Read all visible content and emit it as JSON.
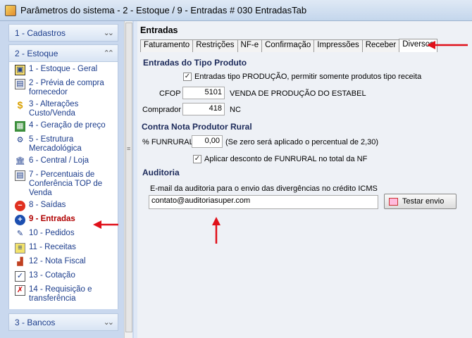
{
  "window": {
    "title": "Parâmetros do sistema - 2 - Estoque / 9 - Entradas # 030 EntradasTab"
  },
  "sidebar": {
    "group_cadastros": "1 - Cadastros",
    "group_estoque": "2 - Estoque",
    "group_bancos": "3 - Bancos",
    "items": [
      {
        "label": "1 - Estoque - Geral",
        "icon": "stock-icon"
      },
      {
        "label": "2 - Prévia de compra fornecedor",
        "icon": "document-icon"
      },
      {
        "label": "3 - Alterações Custo/Venda",
        "icon": "dollar-icon"
      },
      {
        "label": "4 - Geração de preço",
        "icon": "price-icon"
      },
      {
        "label": "5 - Estrutura Mercadológica",
        "icon": "structure-icon"
      },
      {
        "label": "6 - Central / Loja",
        "icon": "building-icon"
      },
      {
        "label": "7 - Percentuais de Conferência TOP de Venda",
        "icon": "document-icon"
      },
      {
        "label": "8 - Saídas",
        "icon": "minus-icon"
      },
      {
        "label": "9 - Entradas",
        "icon": "plus-icon"
      },
      {
        "label": "10 - Pedidos",
        "icon": "orders-icon"
      },
      {
        "label": "11 - Receitas",
        "icon": "recipes-icon"
      },
      {
        "label": "12 - Nota Fiscal",
        "icon": "invoice-icon"
      },
      {
        "label": "13 - Cotação",
        "icon": "quote-icon"
      },
      {
        "label": "14 - Requisição e transferência",
        "icon": "transfer-icon"
      }
    ]
  },
  "main": {
    "title": "Entradas",
    "tabs": [
      "Faturamento",
      "Restrições",
      "NF-e",
      "Confirmação",
      "Impressões",
      "Receber",
      "Diversos"
    ],
    "active_tab": "Diversos",
    "tipo_produto": {
      "header": "Entradas do Tipo Produto",
      "checkbox_label": "Entradas tipo PRODUÇÃO, permitir somente produtos tipo receita",
      "cfop_label": "CFOP",
      "cfop_value": "5101",
      "cfop_desc": "VENDA DE PRODUÇÃO DO ESTABEL",
      "comprador_label": "Comprador",
      "comprador_value": "418",
      "comprador_desc": "NC"
    },
    "produtor_rural": {
      "header": "Contra Nota Produtor Rural",
      "funrural_label": "% FUNRURAL",
      "funrural_value": "0,00",
      "funrural_hint": "(Se zero será aplicado o percentual de 2,30)",
      "checkbox_label": "Aplicar desconto de FUNRURAL no total da NF"
    },
    "auditoria": {
      "header": "Auditoria",
      "email_label": "E-mail da auditoria para o envio das divergências no crédito ICMS",
      "email_value": "contato@auditoriasuper.com",
      "test_button": "Testar envio"
    }
  },
  "colors": {
    "accent_red": "#e0101a",
    "link_blue": "#1c3d8c"
  }
}
